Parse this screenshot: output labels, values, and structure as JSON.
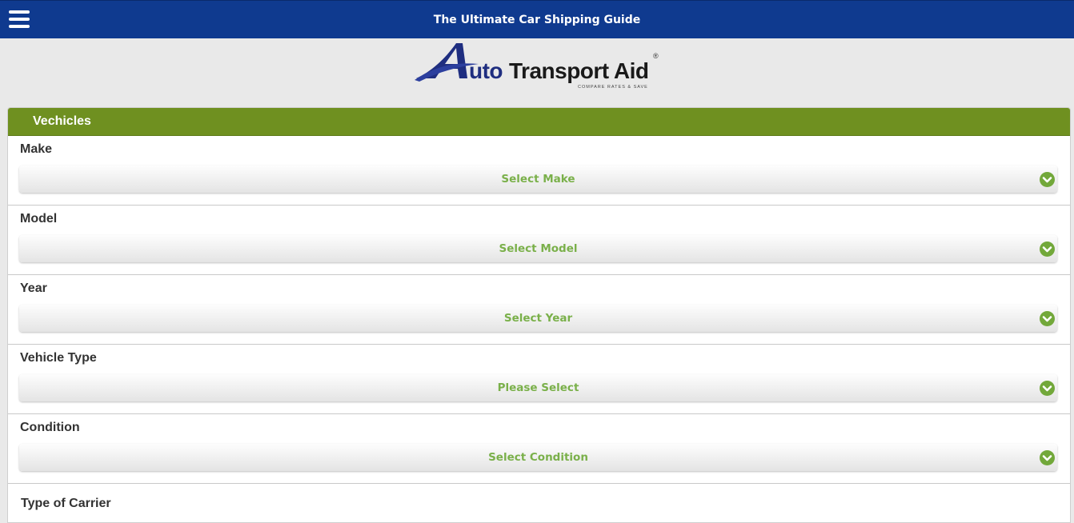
{
  "header": {
    "title": "The Ultimate Car Shipping Guide",
    "menu_icon": "hamburger-menu-icon"
  },
  "logo": {
    "word_uto": "uto",
    "word_transport_aid": "Transport Aid",
    "tagline": "COMPARE RATES & SAVE",
    "registered": "®"
  },
  "panel": {
    "title": "Vechicles",
    "fields": [
      {
        "label": "Make",
        "value": "Select Make"
      },
      {
        "label": "Model",
        "value": "Select Model"
      },
      {
        "label": "Year",
        "value": "Select Year"
      },
      {
        "label": "Vehicle Type",
        "value": "Please Select"
      },
      {
        "label": "Condition",
        "value": "Select Condition"
      }
    ],
    "next_label": "Type of Carrier"
  },
  "colors": {
    "topbar": "#0f3a8f",
    "panel_header": "#6f9020",
    "select_text": "#7ab04a",
    "chevron": "#72a83a"
  }
}
